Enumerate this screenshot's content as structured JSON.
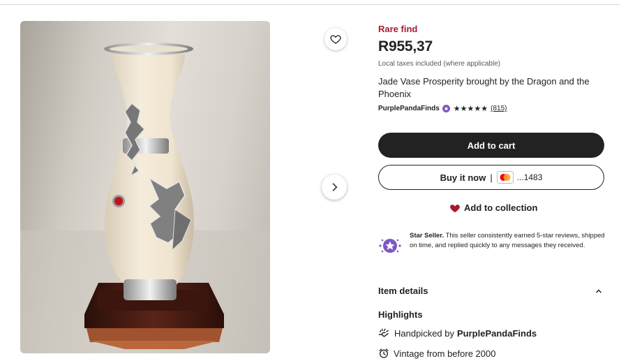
{
  "product": {
    "badge": "Rare find",
    "price": "R955,37",
    "tax_note": "Local taxes included (where applicable)",
    "title": "Jade Vase Prosperity brought by the Dragon and the Phoenix"
  },
  "shop": {
    "name": "PurplePandaFinds",
    "stars": "★★★★★",
    "rating": 5,
    "review_count": "(815)"
  },
  "actions": {
    "add_to_cart": "Add to cart",
    "buy_it_now": "Buy it now",
    "separator": "|",
    "card_last_digits": "...1483",
    "add_to_collection": "Add to collection"
  },
  "star_seller": {
    "heading": "Star Seller.",
    "description": " This seller consistently earned 5-star reviews, shipped on time, and replied quickly to any messages they received."
  },
  "details": {
    "item_details_label": "Item details",
    "highlights_label": "Highlights",
    "handpicked_prefix": "Handpicked by",
    "handpicked_shop": "PurplePandaFinds",
    "vintage": "Vintage from before 2000"
  },
  "icons": {
    "favorite": "heart-outline-icon",
    "next": "chevron-right-icon",
    "collection": "heart-filled-icon",
    "star_seller": "star-seller-badge-icon",
    "collapse": "chevron-up-icon",
    "handpicked": "hand-icon",
    "vintage": "alarm-clock-icon",
    "card": "mastercard-icon"
  },
  "colors": {
    "rare_find": "#a61a2e",
    "star_seller_purple": "#7f57c2",
    "collection_heart": "#a61a2e",
    "primary_button": "#222222"
  }
}
